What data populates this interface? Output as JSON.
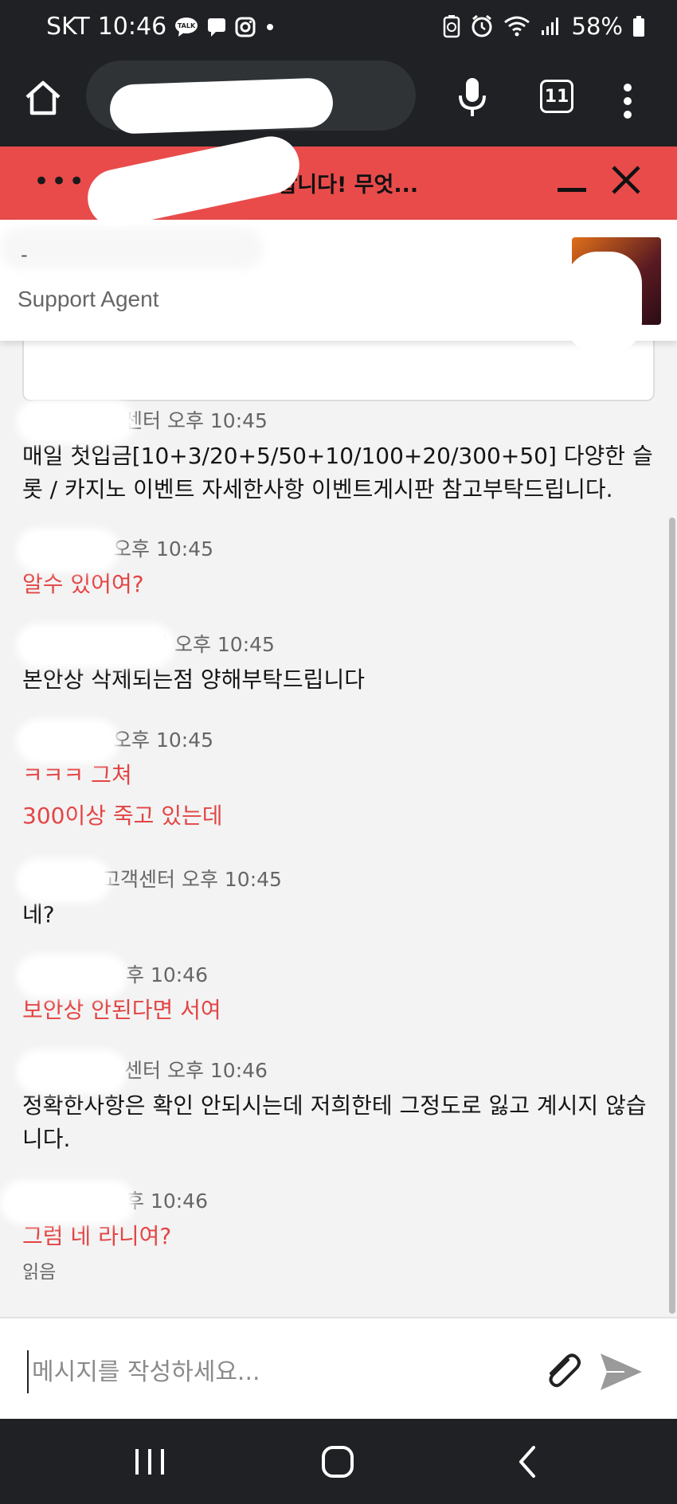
{
  "status_bar": {
    "carrier": "SKT",
    "time": "10:46",
    "battery": "58%",
    "left_icons": [
      "talk-icon",
      "message-icon",
      "instagram-icon",
      "dot-icon"
    ],
    "right_icons": [
      "recycle-icon",
      "alarm-icon",
      "wifi-icon",
      "signal-icon",
      "battery-icon"
    ]
  },
  "browser": {
    "tabs_count": "11"
  },
  "chat_header": {
    "menu_dots": "•••",
    "title": "오신것을 환영합니다! 무엇..."
  },
  "agent": {
    "name": "-",
    "role": "Support Agent"
  },
  "messages": [
    {
      "sender": "agent",
      "meta": "센터 오후 10:45",
      "text": "매일 첫입금[10+3/20+5/50+10/100+20/300+50] 다양한 슬롯 / 카지노 이벤트 자세한사항 이벤트게시판 참고부탁드립니다."
    },
    {
      "sender": "user",
      "meta": "오후 10:45",
      "text": "알수 있어여?"
    },
    {
      "sender": "agent",
      "meta": "터 오후 10:45",
      "text": "본안상 삭제되는점 양해부탁드립니다"
    },
    {
      "sender": "user",
      "meta": "오후 10:45",
      "text": "ㅋㅋㅋ 그쳐"
    },
    {
      "sender": "user",
      "meta": "",
      "text": "300이상 죽고 있는데"
    },
    {
      "sender": "agent",
      "meta": "고객센터 오후 10:45",
      "text": "네?"
    },
    {
      "sender": "user",
      "meta": "후 10:46",
      "text": "보안상 안된다면 서여"
    },
    {
      "sender": "agent",
      "meta": "센터 오후 10:46",
      "text": "정확한사항은 확인 안되시는데 저희한테 그정도로 잃고 계시지 않습니다."
    },
    {
      "sender": "user",
      "meta": "후 10:46",
      "text": "그럼 네 라니여?"
    }
  ],
  "read_label": "읽음",
  "composer": {
    "placeholder": "메시지를 작성하세요..."
  },
  "colors": {
    "header_red": "#e94b4b",
    "user_text": "#e34545",
    "system_dark": "#1f2124"
  }
}
